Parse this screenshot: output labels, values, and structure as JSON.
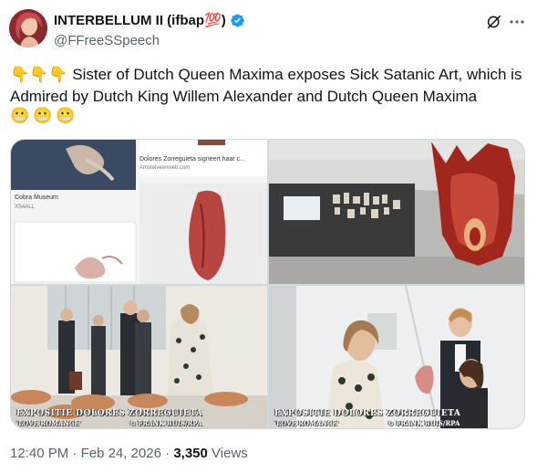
{
  "author": {
    "display_name": "INTERBELLUM II (ifbap",
    "name_emoji": "💯",
    "name_suffix": ")",
    "handle": "@FFreeSSpeech"
  },
  "tweet": {
    "text": "Sister of Dutch Queen Maxima exposes Sick Satanic Art, which is Admired by Dutch King Willem Alexander and Dutch Queen Maxima",
    "leading_emojis": [
      "👇",
      "👇",
      "👇"
    ],
    "trailing_emojis": [
      "😬",
      "😬",
      "😬"
    ]
  },
  "media": {
    "image1": {
      "card1_title": "Dolores Zorreguieta signeert haar c...",
      "card1_source": "Amstelveenweb.com",
      "card2_title": "Cobra Museum",
      "card2_source": "XS4ALL"
    },
    "image3": {
      "caption_line1": "EXPOSITIE DOLORES ZORREGUIETA",
      "caption_line2": "'LOVE ROMANCE'",
      "caption_credit": "© FRANK BUIS/RPA"
    },
    "image4": {
      "caption_line1": "EXPOSITIE DOLORES ZORREGUIETA",
      "caption_line2": "'LOVE ROMANCE'",
      "caption_credit": "© FRANK BUIS/RPA"
    }
  },
  "footer": {
    "time": "12:40 PM",
    "separator": "·",
    "date": "Feb 24, 2026",
    "views_count": "3,350",
    "views_label": "Views"
  },
  "colors": {
    "verified": "#1d9bf0",
    "secondary_text": "#536471"
  }
}
